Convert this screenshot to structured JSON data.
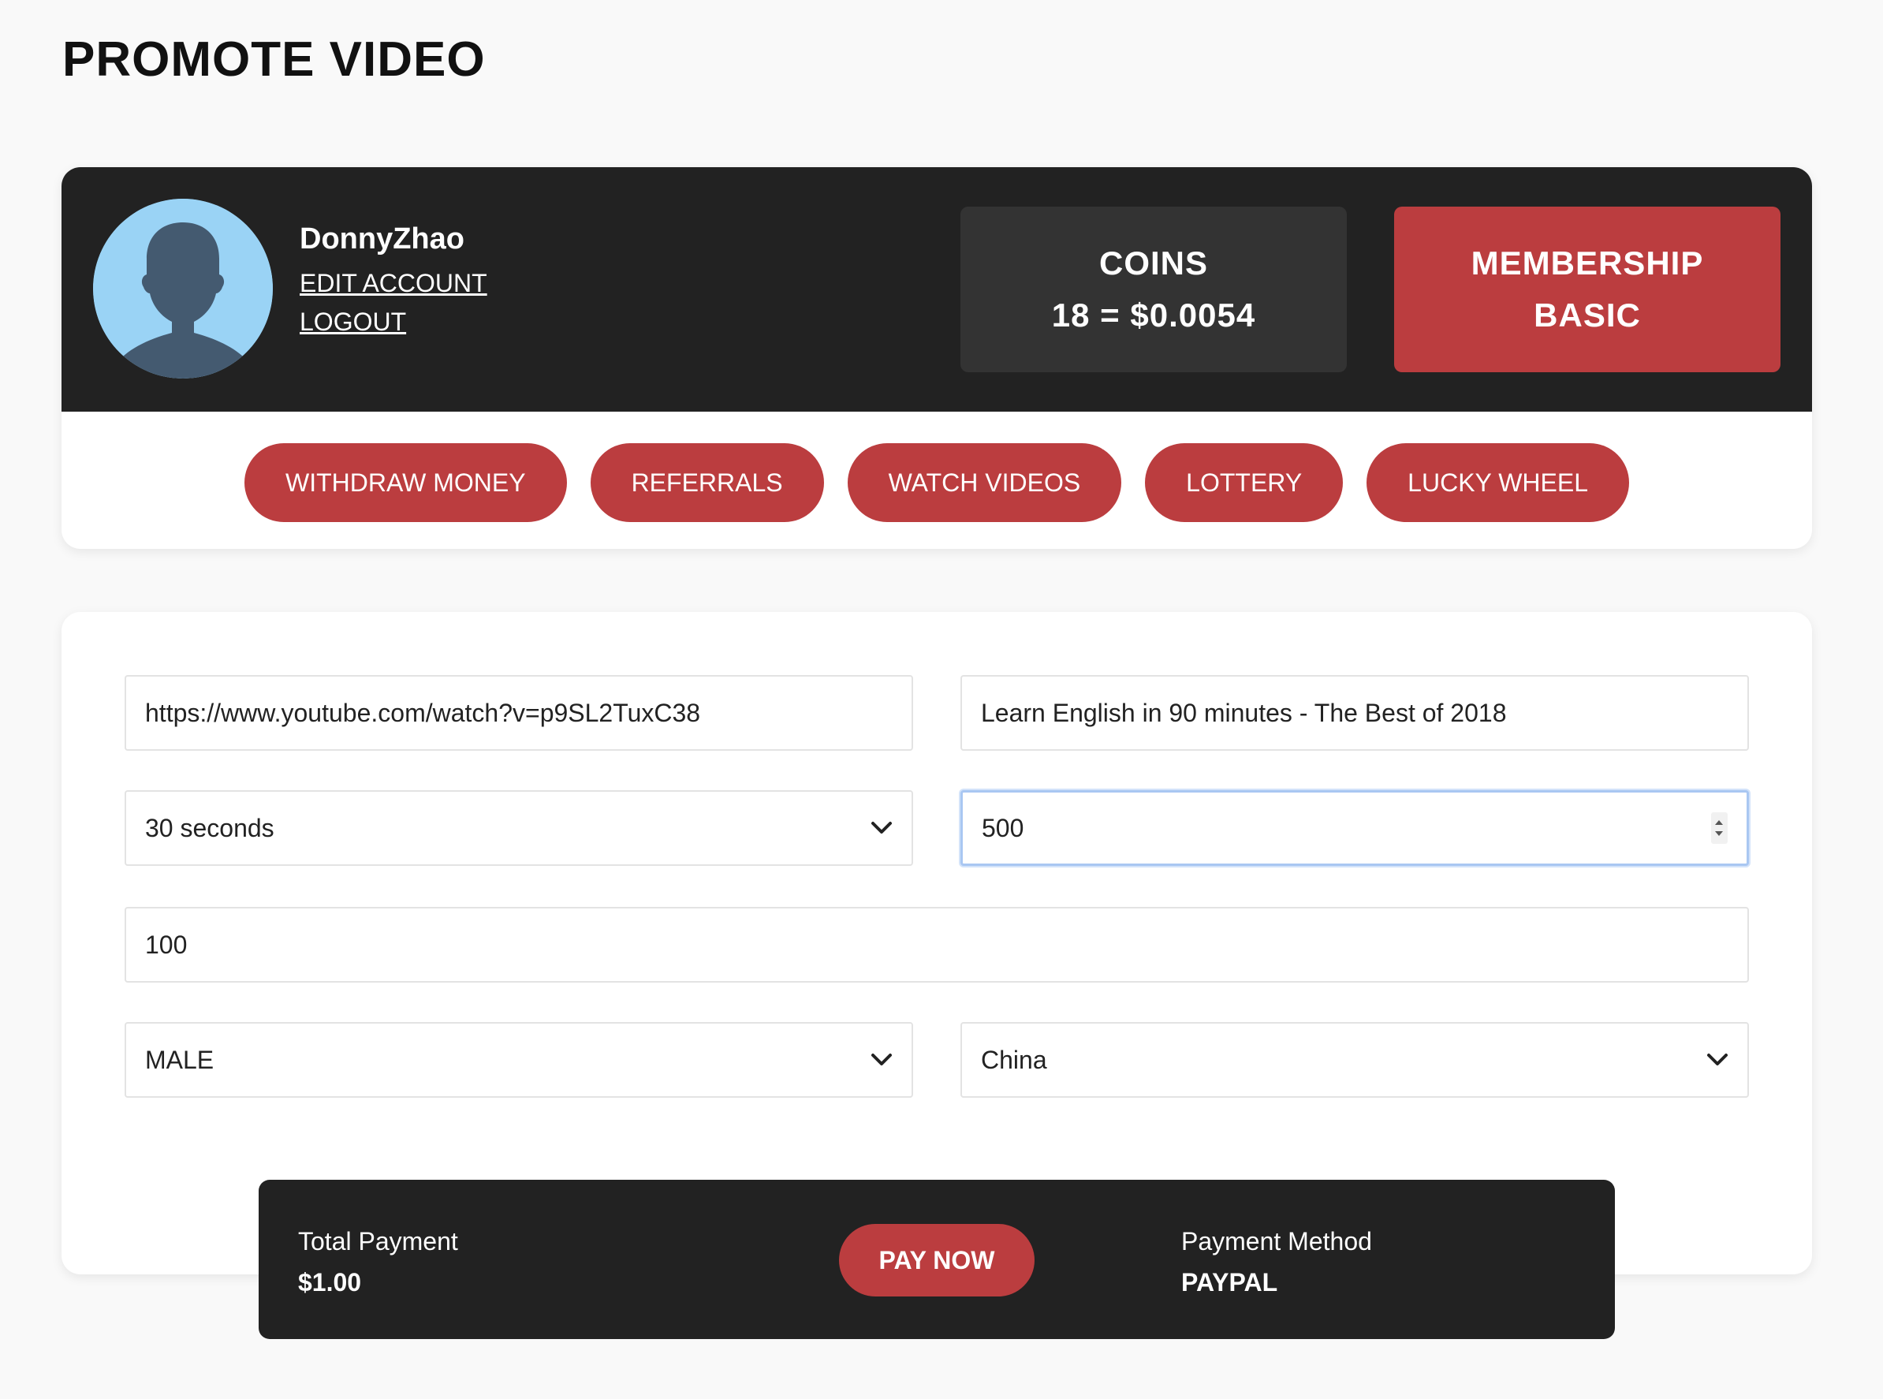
{
  "page": {
    "title": "PROMOTE VIDEO"
  },
  "profile": {
    "username": "DonnyZhao",
    "edit_account": "EDIT ACCOUNT",
    "logout": "LOGOUT",
    "avatar_icon": "user-silhouette-icon"
  },
  "stats": {
    "coins_label": "COINS",
    "coins_value": "18 = $0.0054",
    "membership_label": "MEMBERSHIP",
    "membership_value": "BASIC"
  },
  "nav": {
    "items": [
      {
        "label": "WITHDRAW MONEY"
      },
      {
        "label": "REFERRALS"
      },
      {
        "label": "WATCH VIDEOS"
      },
      {
        "label": "LOTTERY"
      },
      {
        "label": "LUCKY WHEEL"
      }
    ]
  },
  "form": {
    "video_url": "https://www.youtube.com/watch?v=p9SL2TuxC38",
    "video_title": "Learn English in 90 minutes - The Best of 2018",
    "duration": "30 seconds",
    "views": "500",
    "budget": "100",
    "gender": "MALE",
    "country": "China"
  },
  "payment": {
    "total_label": "Total Payment",
    "total_value": "$1.00",
    "pay_button": "PAY NOW",
    "method_label": "Payment Method",
    "method_value": "PAYPAL"
  },
  "colors": {
    "accent": "#bb3d3f",
    "dark": "#222222",
    "coins_bg": "#333333",
    "avatar_bg": "#9ad3f5",
    "page_bg": "#f9f9f9"
  }
}
